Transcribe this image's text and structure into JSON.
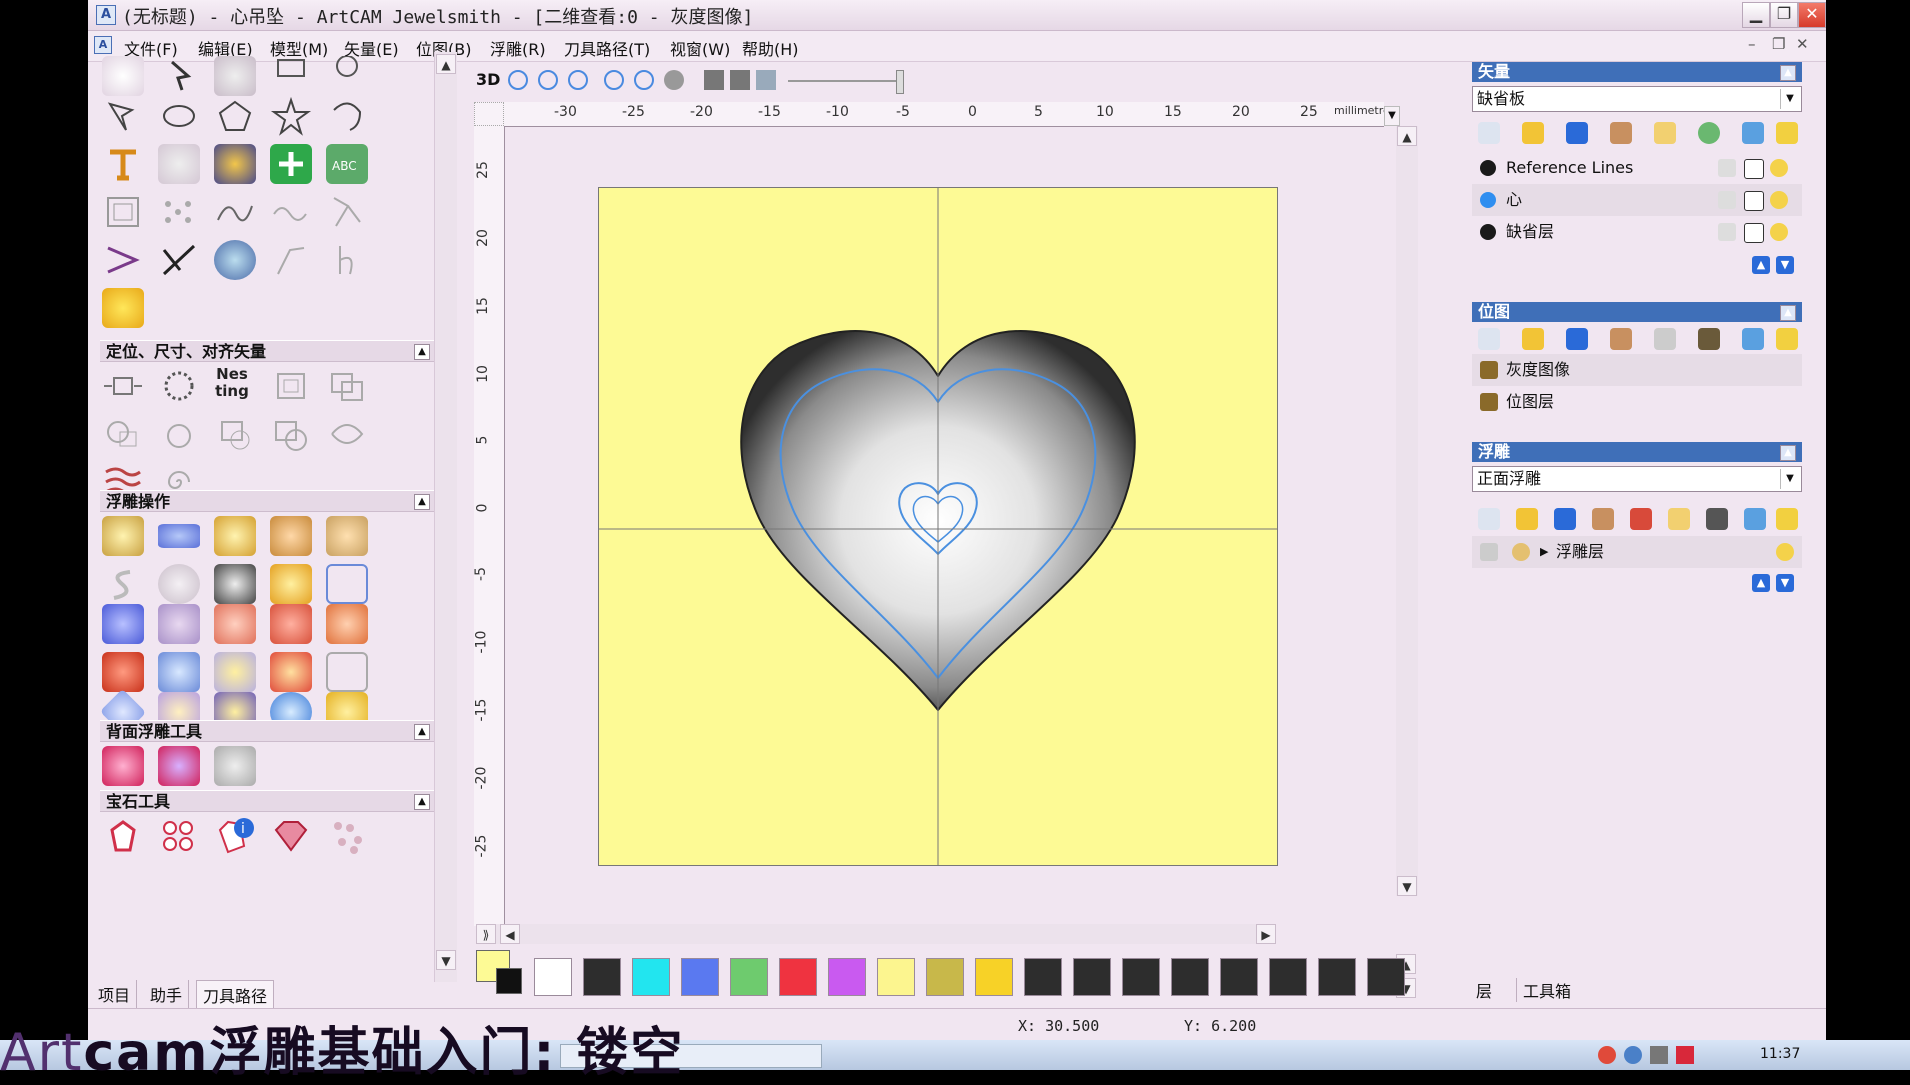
{
  "window": {
    "title": "(无标题) - 心吊坠 - ArtCAM Jewelsmith - [二维查看:0 - 灰度图像]"
  },
  "menu": [
    {
      "label": "文件(F)"
    },
    {
      "label": "编辑(E)"
    },
    {
      "label": "模型(M)"
    },
    {
      "label": "矢量(E)"
    },
    {
      "label": "位图(B)"
    },
    {
      "label": "浮雕(R)"
    },
    {
      "label": "刀具路径(T)"
    },
    {
      "label": "视窗(W)"
    },
    {
      "label": "帮助(H)"
    }
  ],
  "left_panel": {
    "sections": [
      {
        "title": "定位、尺寸、对齐矢量"
      },
      {
        "title": "浮雕操作"
      },
      {
        "title": "背面浮雕工具"
      },
      {
        "title": "宝石工具"
      }
    ],
    "nesting_label": "Nesting",
    "tabs": [
      "项目",
      "助手",
      "刀具路径"
    ]
  },
  "view": {
    "toolbar_3d": "3D",
    "ruler_unit": "millimetres",
    "ruler_h_ticks": [
      "-30",
      "-25",
      "-20",
      "-15",
      "-10",
      "-5",
      "0",
      "5",
      "10",
      "15",
      "20",
      "25"
    ],
    "ruler_v_ticks": [
      "25",
      "20",
      "15",
      "10",
      "5",
      "0",
      "-5",
      "-10",
      "-15",
      "-20",
      "-25"
    ],
    "canvas_color": "#fdfa95",
    "palette": [
      "#ffffff",
      "#2d2d2d",
      "#22e5ef",
      "#5a79f0",
      "#6ecb6e",
      "#ef3340",
      "#c95af0",
      "#fcf58f",
      "#c8b84a",
      "#f7d227",
      "#2d2d2d",
      "#2d2d2d",
      "#2d2d2d",
      "#2d2d2d",
      "#2d2d2d",
      "#2d2d2d",
      "#2d2d2d",
      "#2d2d2d"
    ]
  },
  "right_panel": {
    "vector": {
      "header": "矢量",
      "dropdown": "缺省板",
      "layers": [
        {
          "name": "Reference Lines",
          "dot": "#1a1a1a"
        },
        {
          "name": "心",
          "dot": "#2f8ef0"
        },
        {
          "name": "缺省层",
          "dot": "#1a1a1a"
        }
      ]
    },
    "bitmap": {
      "header": "位图",
      "layers": [
        {
          "name": "灰度图像"
        },
        {
          "name": "位图层"
        }
      ]
    },
    "relief": {
      "header": "浮雕",
      "dropdown": "正面浮雕",
      "layers": [
        {
          "name": "浮雕层"
        }
      ]
    },
    "tabs": [
      "层",
      "工具箱"
    ]
  },
  "status": {
    "x": "X: 30.500",
    "y": "Y: 6.200"
  },
  "taskbar": {
    "clock": "11:37"
  },
  "overlay": {
    "prefix": "Art",
    "text": "cam浮雕基础入门: 镂空"
  }
}
